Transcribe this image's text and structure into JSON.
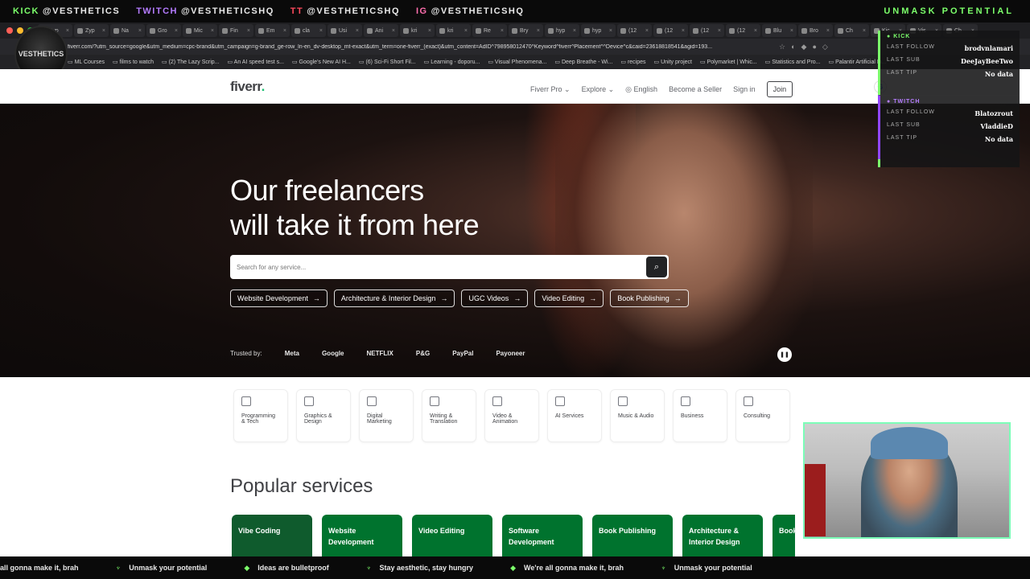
{
  "stream": {
    "socials": [
      {
        "platform": "KICK",
        "handle": "@VESTHETICS"
      },
      {
        "platform": "TWITCH",
        "handle": "@VESTHETICSHQ"
      },
      {
        "platform": "TT",
        "handle": "@VESTHETICSHQ"
      },
      {
        "platform": "IG",
        "handle": "@VESTHETICSHQ"
      }
    ],
    "slogan": "UNMASK POTENTIAL",
    "avatar_text": "VESTHETICS",
    "overlay": {
      "kick_label": "KICK",
      "twitch_label": "TWITCH",
      "last_follow_label": "LAST FOLLOW",
      "last_sub_label": "LAST SUB",
      "last_tip_label": "LAST TIP",
      "kick": {
        "last_follow": "brodvnlamari",
        "last_sub": "DeeJayBeeTwo",
        "last_tip": "No data"
      },
      "twitch": {
        "last_follow": "Blatozrout",
        "last_sub": "VladdieD",
        "last_tip": "No data"
      }
    },
    "ticker": [
      "all gonna make it, brah",
      "Unmask your potential",
      "Ideas are bulletproof",
      "Stay aesthetic, stay hungry",
      "We're all gonna make it, brah",
      "Unmask your potential"
    ],
    "colors": {
      "kick": "#7CFF6B",
      "twitch": "#9146ff",
      "fiverr_green": "#1dbf73",
      "service_green": "#00732e"
    }
  },
  "browser": {
    "tabs": [
      "Zyp",
      "Zyp",
      "Na",
      "Gro",
      "Mic",
      "Fin",
      "Em",
      "cla",
      "Usi",
      "Ani",
      "kri",
      "kri",
      "Re",
      "Bry",
      "hyp",
      "hyp",
      "(12",
      "(12",
      "(12",
      "(12",
      "Blu",
      "Bro",
      "Ch",
      "Kic",
      "Vis",
      "Ch"
    ],
    "url": "fiverr.com/?utm_source=google&utm_medium=cpc-brand&utm_campaign=g-brand_ge-row_ln-en_dv-desktop_mt-exact&utm_term=one-fiverr_(exact)&utm_content=AdID^798958012470^Keyword^fiverr^Placement^^Device^c&caid=23618818541&agid=193...",
    "bookmarks": [
      "ML Courses",
      "films to watch",
      "(2) The Lazy Scrip...",
      "An AI speed test s...",
      "Google's New AI H...",
      "(6) Sci-Fi Short Fil...",
      "Learning - doporu...",
      "Visual Phenomena...",
      "Deep Breathe - Wi...",
      "recipes",
      "Unity project",
      "Polymarket | Whic...",
      "Statistics and Pro...",
      "Palantir Artificial In..."
    ]
  },
  "fiverr": {
    "logo": "fiverr",
    "nav": {
      "pro": "Fiverr Pro",
      "explore": "Explore",
      "language": "English",
      "become_seller": "Become a Seller",
      "sign_in": "Sign in",
      "join": "Join"
    },
    "hero": {
      "title_line1": "Our freelancers",
      "title_line2": "will take it from here",
      "search_placeholder": "Search for any service...",
      "chips": [
        "Website Development",
        "Architecture & Interior Design",
        "UGC Videos",
        "Video Editing",
        "Book Publishing"
      ],
      "trusted_label": "Trusted by:",
      "brands": [
        "Meta",
        "Google",
        "NETFLIX",
        "P&G",
        "PayPal",
        "Payoneer"
      ]
    },
    "categories": [
      "Programming & Tech",
      "Graphics & Design",
      "Digital Marketing",
      "Writing & Translation",
      "Video & Animation",
      "AI Services",
      "Music & Audio",
      "Business",
      "Consulting"
    ],
    "popular_title": "Popular services",
    "popular": [
      "Vibe Coding",
      "Website Development",
      "Video Editing",
      "Software Development",
      "Book Publishing",
      "Architecture & Interior Design",
      "Book"
    ]
  }
}
